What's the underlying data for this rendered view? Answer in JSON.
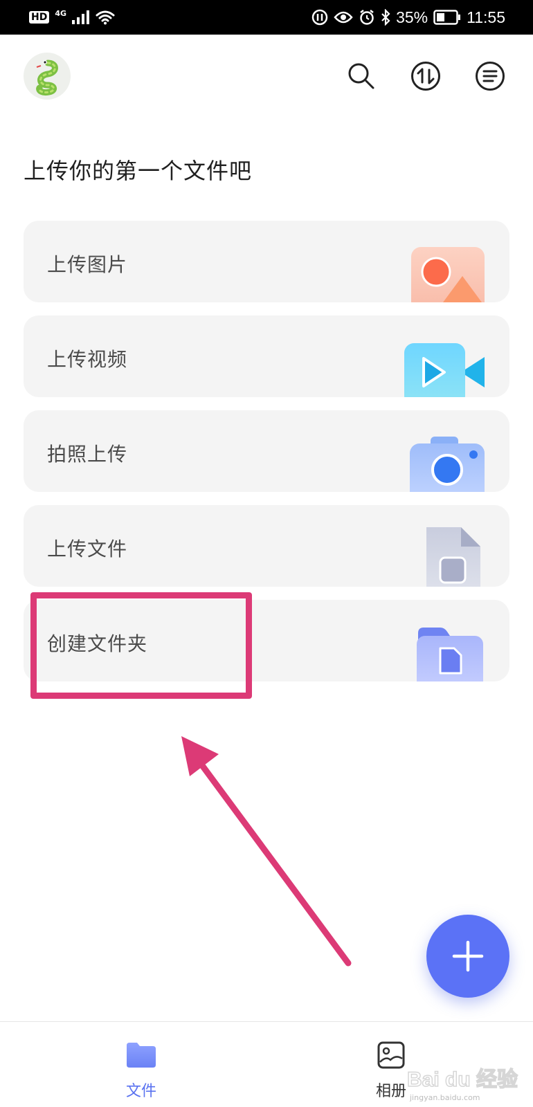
{
  "status_bar": {
    "hd": "HD",
    "network": "4G",
    "battery": "35%",
    "time": "11:55",
    "icons": [
      "signal-icon",
      "wifi-icon",
      "data-saver-icon",
      "eye-comfort-icon",
      "alarm-icon",
      "bluetooth-icon",
      "battery-icon"
    ]
  },
  "header": {
    "avatar_icon": "snake-avatar-icon",
    "actions": [
      "search-icon",
      "transfer-icon",
      "menu-icon"
    ]
  },
  "main": {
    "title": "上传你的第一个文件吧",
    "upload_options": [
      {
        "label": "上传图片",
        "icon": "image-icon"
      },
      {
        "label": "上传视频",
        "icon": "video-icon"
      },
      {
        "label": "拍照上传",
        "icon": "camera-icon"
      },
      {
        "label": "上传文件",
        "icon": "document-icon"
      },
      {
        "label": "创建文件夹",
        "icon": "folder-icon"
      }
    ]
  },
  "fab": {
    "icon": "plus-icon"
  },
  "bottom_nav": {
    "items": [
      {
        "label": "文件",
        "icon": "folder-tab-icon",
        "active": true
      },
      {
        "label": "相册",
        "icon": "album-icon",
        "active": false
      }
    ]
  },
  "watermark": {
    "text": "Bai du 经验",
    "sub": "jingyan.baidu.com"
  },
  "colors": {
    "accent": "#5b72f6",
    "annotation": "#dc3a76",
    "card_bg": "#f4f4f4"
  }
}
